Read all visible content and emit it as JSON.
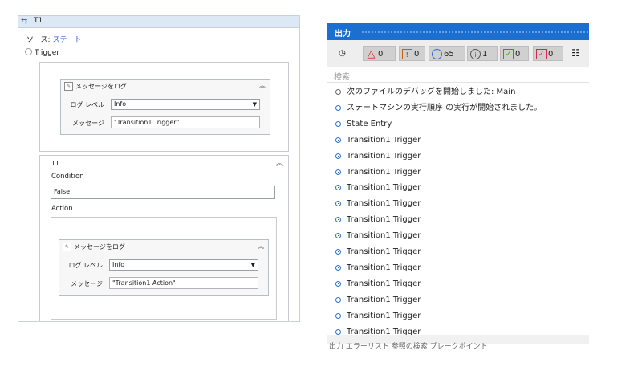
{
  "designer": {
    "title": "T1",
    "source_label": "ソース:",
    "source_link": "ステート",
    "trigger_label": "Trigger",
    "trigger_activity": {
      "title": "メッセージをログ",
      "level_label": "ログ レベル",
      "level_value": "Info",
      "message_label": "メッセージ",
      "message_value": "\"Transition1 Trigger\""
    },
    "transition": {
      "title": "T1",
      "condition_label": "Condition",
      "condition_value": "False",
      "action_label": "Action",
      "action_activity": {
        "title": "メッセージをログ",
        "level_label": "ログ レベル",
        "level_value": "Info",
        "message_label": "メッセージ",
        "message_value": "\"Transition1 Action\""
      }
    }
  },
  "output": {
    "title": "出力",
    "toolbar": {
      "warnings": "0",
      "errors": "0",
      "info": "65",
      "trace": "1",
      "success": "0",
      "failed": "0"
    },
    "search_placeholder": "検索",
    "rows": [
      {
        "text": "次のファイルのデバッグを開始しました: Main",
        "level": "trace"
      },
      {
        "text": "ステートマシンの実行順序 の実行が開始されました。",
        "level": "info"
      },
      {
        "text": "State Entry",
        "level": "info"
      },
      {
        "text": "Transition1 Trigger",
        "level": "info"
      },
      {
        "text": "Transition1 Trigger",
        "level": "info"
      },
      {
        "text": "Transition1 Trigger",
        "level": "info"
      },
      {
        "text": "Transition1 Trigger",
        "level": "info"
      },
      {
        "text": "Transition1 Trigger",
        "level": "info"
      },
      {
        "text": "Transition1 Trigger",
        "level": "info"
      },
      {
        "text": "Transition1 Trigger",
        "level": "info"
      },
      {
        "text": "Transition1 Trigger",
        "level": "info"
      },
      {
        "text": "Transition1 Trigger",
        "level": "info"
      },
      {
        "text": "Transition1 Trigger",
        "level": "info"
      },
      {
        "text": "Transition1 Trigger",
        "level": "info"
      },
      {
        "text": "Transition1 Trigger",
        "level": "info"
      },
      {
        "text": "Transition1 Trigger",
        "level": "info"
      }
    ],
    "footer": "出力 エラーリスト 参照の検索 ブレークポイント"
  }
}
